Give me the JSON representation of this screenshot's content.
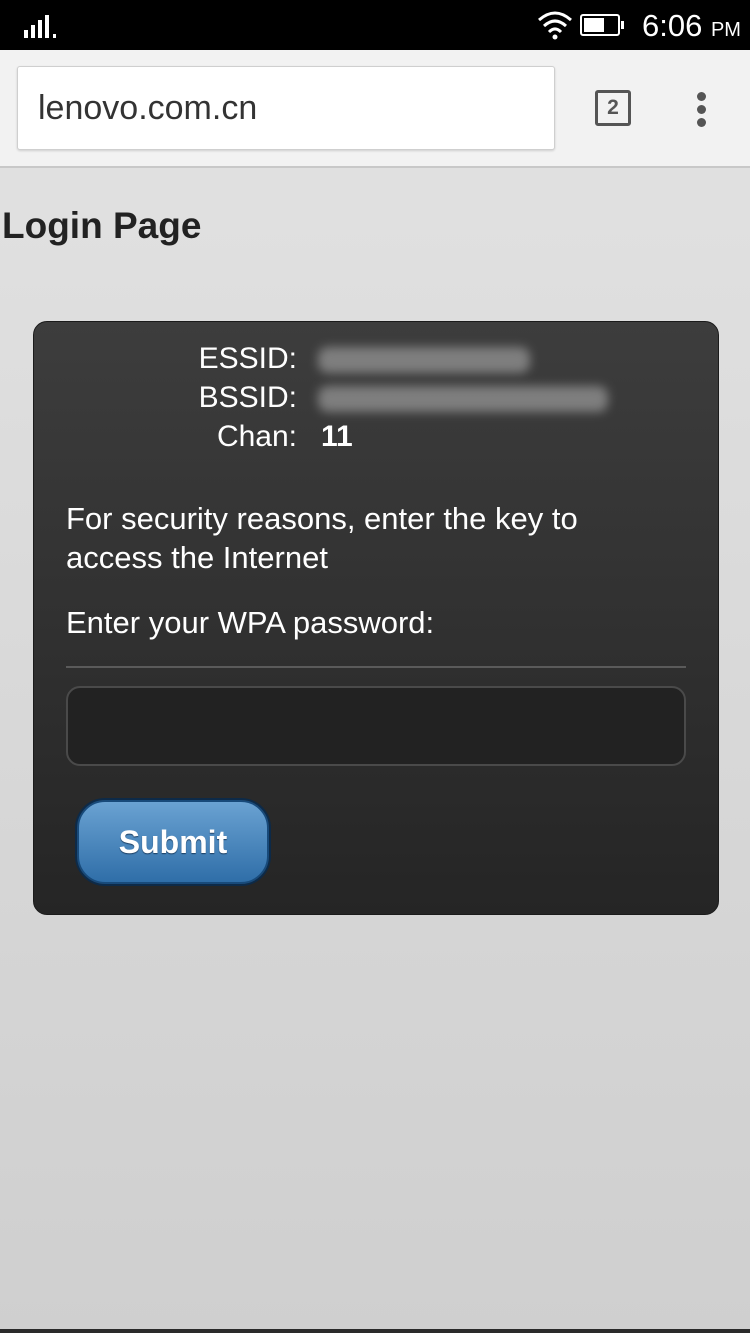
{
  "status_bar": {
    "time": "6:06",
    "ampm": "PM",
    "icons": [
      "signal-icon",
      "wifi-icon",
      "battery-icon"
    ]
  },
  "browser": {
    "url": "lenovo.com.cn",
    "tab_count": "2",
    "menu_icon": "overflow-menu-icon"
  },
  "page": {
    "title": "Login Page",
    "panel": {
      "essid_label": "ESSID:",
      "bssid_label": "BSSID:",
      "chan_label": "Chan:",
      "chan_value": "11",
      "security_message": "For security reasons, enter the key to access the Internet",
      "password_prompt": "Enter your WPA password:",
      "password_value": "",
      "submit_label": "Submit"
    }
  },
  "colors": {
    "panel_bg": "#2e2e2e",
    "button_accent": "#3d7ab4",
    "page_bg": "#d9d9d9"
  }
}
